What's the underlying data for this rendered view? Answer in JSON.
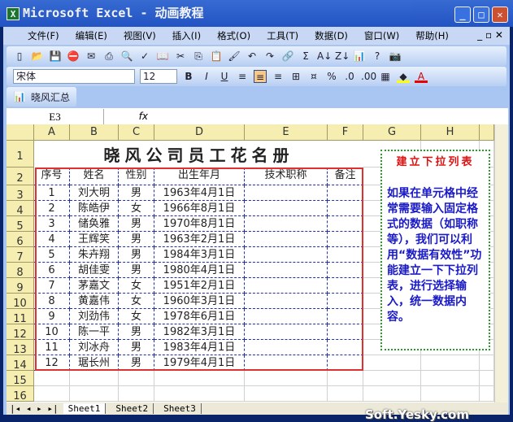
{
  "window": {
    "title": "Microsoft Excel - 动画教程"
  },
  "menu": [
    "文件(F)",
    "编辑(E)",
    "视图(V)",
    "插入(I)",
    "格式(O)",
    "工具(T)",
    "数据(D)",
    "窗口(W)",
    "帮助(H)"
  ],
  "format_toolbar": {
    "font": "宋体",
    "size": "12",
    "bold": "B",
    "italic": "I",
    "underline": "U",
    "percent": "%"
  },
  "custom_toolbar": {
    "label": "晓风汇总"
  },
  "formula_bar": {
    "name_box": "E3",
    "fx": "fx",
    "value": ""
  },
  "columns": [
    "A",
    "B",
    "C",
    "D",
    "E",
    "F",
    "G",
    "H"
  ],
  "rows": [
    "1",
    "2",
    "3",
    "4",
    "5",
    "6",
    "7",
    "8",
    "9",
    "10",
    "11",
    "12",
    "13",
    "14",
    "15",
    "16"
  ],
  "sheet": {
    "title": "晓风公司员工花名册",
    "headers": [
      "序号",
      "姓名",
      "性别",
      "出生年月",
      "技术职称",
      "备注"
    ],
    "records": [
      [
        "1",
        "刘大明",
        "男",
        "1963年4月1日"
      ],
      [
        "2",
        "陈皓伊",
        "女",
        "1966年8月1日"
      ],
      [
        "3",
        "储奂雅",
        "男",
        "1970年8月1日"
      ],
      [
        "4",
        "王辉笑",
        "男",
        "1963年2月1日"
      ],
      [
        "5",
        "朱卉翔",
        "男",
        "1984年3月1日"
      ],
      [
        "6",
        "胡佳雯",
        "男",
        "1980年4月1日"
      ],
      [
        "7",
        "茅嘉文",
        "女",
        "1951年2月1日"
      ],
      [
        "8",
        "黄嘉伟",
        "女",
        "1960年3月1日"
      ],
      [
        "9",
        "刘劲伟",
        "女",
        "1978年6月1日"
      ],
      [
        "10",
        "陈一平",
        "男",
        "1982年3月1日"
      ],
      [
        "11",
        "刘冰舟",
        "男",
        "1983年4月1日"
      ],
      [
        "12",
        "琚长州",
        "男",
        "1979年4月1日"
      ]
    ]
  },
  "note": {
    "title": "建立下拉列表",
    "body": "如果在单元格中经常需要输入固定格式的数据（如职称等），我们可以利用“数据有效性”功能建立一下下拉列表，进行选择输入，统一数据内容。"
  },
  "tabs": [
    "Sheet1",
    "Sheet2",
    "Sheet3"
  ],
  "watermark": "Soft.Yesky.com"
}
